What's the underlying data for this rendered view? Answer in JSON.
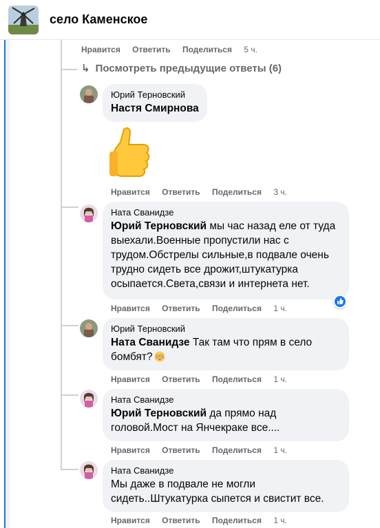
{
  "header": {
    "group_title": "село Каменское",
    "group_icon": "windmill-icon"
  },
  "actions": {
    "like": "Нравится",
    "reply": "Ответить",
    "share": "Поделиться"
  },
  "view_previous": "Посмотреть предыдущие ответы (6)",
  "top_actions_time": "5 ч.",
  "comments": [
    {
      "author": "Юрий Терновский",
      "mention": "Настя Смирнова",
      "text": "",
      "sticker": "thumbs-up-emoji",
      "time": "3 ч."
    },
    {
      "author": "Ната Сванидзе",
      "mention": "Юрий Терновский",
      "text": " мы час назад еле от туда выехали.Военные пропустили нас с трудом.Обстрелы сильные,в подвале очень трудно сидеть все дрожит,штукатурка осыпается.Света,связи и интернета нет.",
      "reaction": "like-icon",
      "time": "1 ч."
    },
    {
      "author": "Юрий Терновский",
      "mention": "Ната Сванидзе",
      "text": " Так там что прям в село бомбят?",
      "emoji": "flushed-face-emoji",
      "time": "1 ч."
    },
    {
      "author": "Ната Сванидзе",
      "mention": "Юрий Терновский",
      "text": " да прямо над головой.Мост на Янчекраке все....",
      "time": "1 ч."
    },
    {
      "author": "Ната Сванидзе",
      "mention": "",
      "text": "Мы даже в подвале не могли сидеть..Штукатурка сыпется и свистит все.",
      "time": "1 ч."
    }
  ],
  "colors": {
    "bubble": "#f0f2f5",
    "meta_text": "#65676b",
    "accent": "#1877f2"
  }
}
